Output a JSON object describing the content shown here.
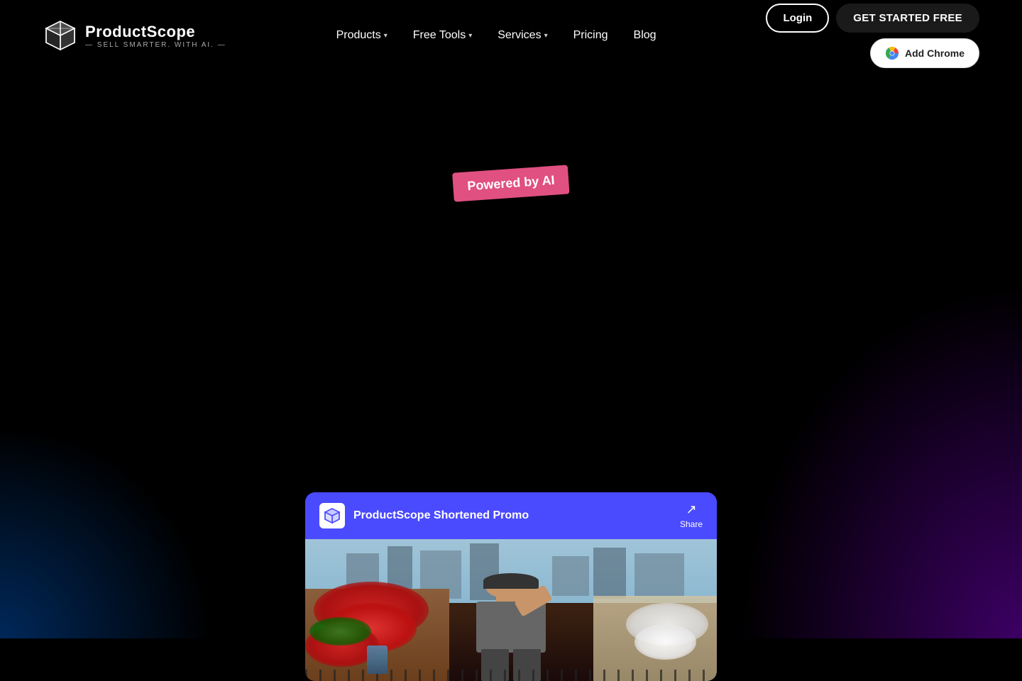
{
  "brand": {
    "name": "ProductScope",
    "tagline": "— SELL SMARTER. WITH AI. —",
    "logo_alt": "ProductScope logo"
  },
  "nav": {
    "items": [
      {
        "label": "Products",
        "has_dropdown": true
      },
      {
        "label": "Free Tools",
        "has_dropdown": true
      },
      {
        "label": "Services",
        "has_dropdown": true
      },
      {
        "label": "Pricing",
        "has_dropdown": false
      },
      {
        "label": "Blog",
        "has_dropdown": false
      }
    ]
  },
  "actions": {
    "login_label": "Login",
    "get_started_label": "GET STARTED FREE",
    "add_chrome_label": "Add Chrome"
  },
  "hero": {
    "badge_text": "Powered by AI"
  },
  "video": {
    "channel_name": "ProductScope Shortened Promo",
    "share_label": "Share"
  }
}
